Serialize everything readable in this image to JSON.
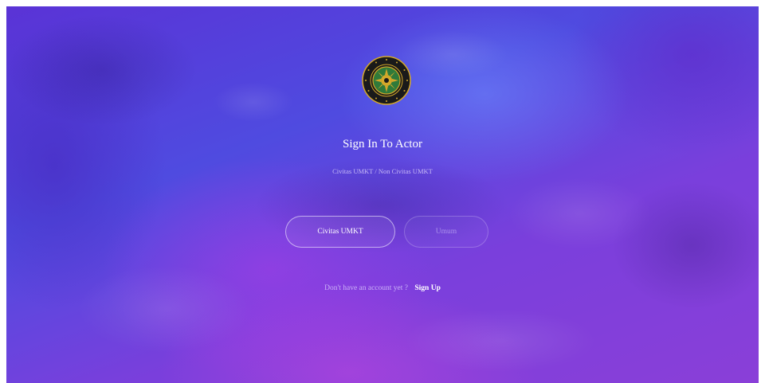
{
  "logo": {
    "icon": "university-seal-icon",
    "text_top": "UNIVERSITAS MUHAMMADIYAH",
    "text_bottom": "KALIMANTAN TIMUR",
    "colors": {
      "ring": "#1a1a1a",
      "gold": "#d4a82a",
      "inner": "#2f7a3a"
    }
  },
  "login": {
    "title": "Sign In To Actor",
    "subtitle": "Civitas UMKT / Non Civitas UMKT",
    "buttons": {
      "civitas_label": "Civitas UMKT",
      "umum_label": "Umum"
    },
    "signup_prompt": "Don't have an account yet ?",
    "signup_link": "Sign Up"
  },
  "theme": {
    "background_primary": "#5a33d6",
    "background_secondary": "#8a3fd8",
    "text": "#ffffff"
  }
}
